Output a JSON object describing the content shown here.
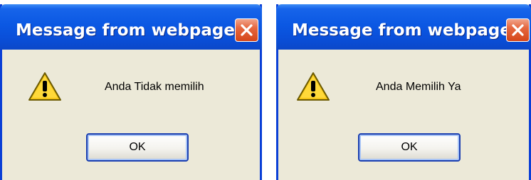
{
  "dialogs": [
    {
      "title": "Message from webpage",
      "icon": "warning-icon",
      "message": "Anda Tidak memilih",
      "ok_label": "OK",
      "close_icon": "close-icon"
    },
    {
      "title": "Message from webpage",
      "icon": "warning-icon",
      "message": "Anda Memilih Ya",
      "ok_label": "OK",
      "close_icon": "close-icon"
    }
  ],
  "colors": {
    "titlebar": "#0b58e3",
    "dialog_body": "#ece9d8",
    "close_button": "#e5673f",
    "warning_fill": "#f5c518"
  }
}
